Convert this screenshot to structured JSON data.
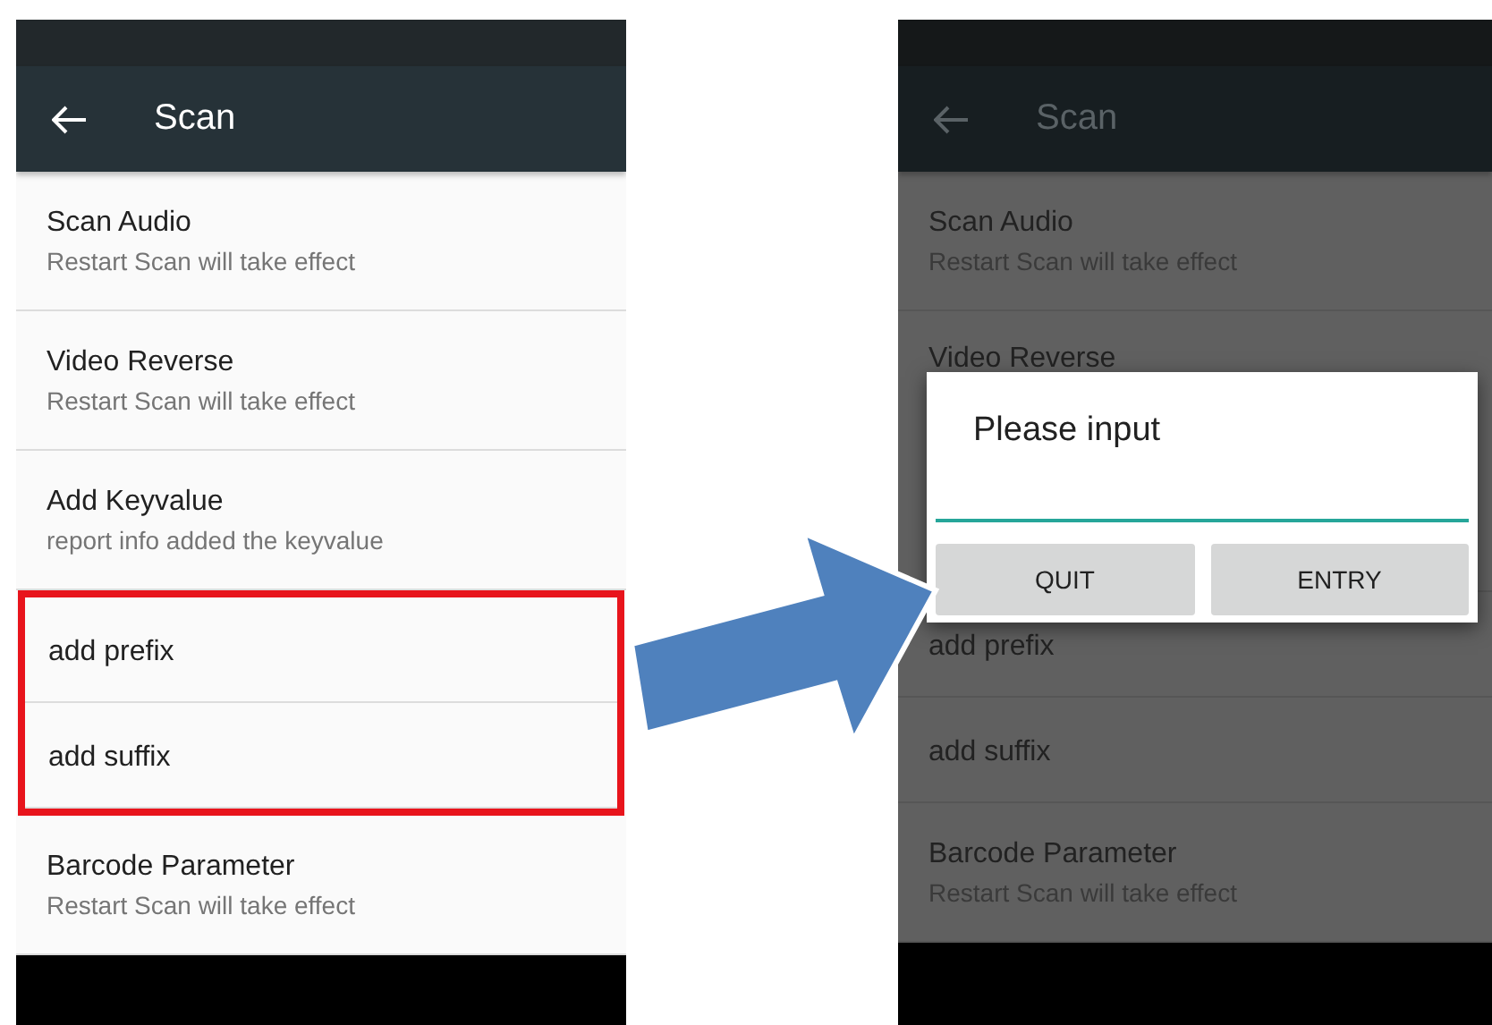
{
  "screens": [
    {
      "dimmed": false,
      "toolbar": {
        "title": "Scan"
      },
      "items": [
        {
          "kind": "two-line",
          "title": "Scan Audio",
          "subtitle": "Restart Scan will take effect",
          "highlighted": false
        },
        {
          "kind": "two-line",
          "title": "Video Reverse",
          "subtitle": "Restart Scan will take effect",
          "highlighted": false
        },
        {
          "kind": "two-line",
          "title": "Add Keyvalue",
          "subtitle": "report info added the keyvalue",
          "highlighted": false
        },
        {
          "kind": "one-line",
          "title": "add prefix",
          "highlighted": true
        },
        {
          "kind": "one-line",
          "title": "add suffix",
          "highlighted": true
        },
        {
          "kind": "two-line",
          "title": "Barcode Parameter",
          "subtitle": "Restart Scan will take effect",
          "highlighted": false
        }
      ]
    },
    {
      "dimmed": true,
      "toolbar": {
        "title": "Scan"
      },
      "items": [
        {
          "kind": "two-line",
          "title": "Scan Audio",
          "subtitle": "Restart Scan will take effect"
        },
        {
          "kind": "under-dialog",
          "title": "Video Reverse"
        },
        {
          "kind": "one-line",
          "title": "add prefix"
        },
        {
          "kind": "one-line",
          "title": "add suffix"
        },
        {
          "kind": "two-line",
          "title": "Barcode Parameter",
          "subtitle": "Restart Scan will take effect"
        }
      ],
      "dialog": {
        "title": "Please input",
        "buttons": [
          "QUIT",
          "ENTRY"
        ]
      }
    }
  ]
}
